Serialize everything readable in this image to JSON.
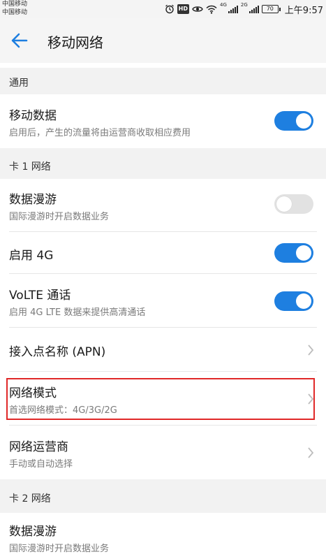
{
  "status_bar": {
    "carrier_1": "中国移动",
    "carrier_2": "中国移动",
    "network_1": "4G",
    "network_2": "2G",
    "battery": "70",
    "time": "上午9:57",
    "icons": [
      "alarm-icon",
      "hd-icon",
      "eye-icon",
      "wifi-icon",
      "signal-icon",
      "battery-icon"
    ]
  },
  "header": {
    "title": "移动网络",
    "back_icon": "arrow-left-icon"
  },
  "sections": {
    "general": "通用",
    "sim1": "卡 1 网络",
    "sim2": "卡 2 网络"
  },
  "items": {
    "mobile_data": {
      "title": "移动数据",
      "subtitle": "启用后，产生的流量将由运营商收取相应费用",
      "enabled": true
    },
    "roaming_1": {
      "title": "数据漫游",
      "subtitle": "国际漫游时开启数据业务",
      "enabled": false
    },
    "enable_4g": {
      "title": "启用 4G",
      "enabled": true
    },
    "volte": {
      "title": "VoLTE 通话",
      "subtitle": "启用 4G LTE 数据来提供高清通话",
      "enabled": true
    },
    "apn": {
      "title": "接入点名称 (APN)"
    },
    "network_mode": {
      "title": "网络模式",
      "subtitle": "首选网络模式：4G/3G/2G"
    },
    "carrier": {
      "title": "网络运营商",
      "subtitle": "手动或自动选择"
    },
    "roaming_2": {
      "title": "数据漫游",
      "subtitle": "国际漫游时开启数据业务"
    }
  },
  "colors": {
    "accent": "#1e7fe0",
    "highlight": "#e02828",
    "section_bg": "#f2f2f2"
  }
}
